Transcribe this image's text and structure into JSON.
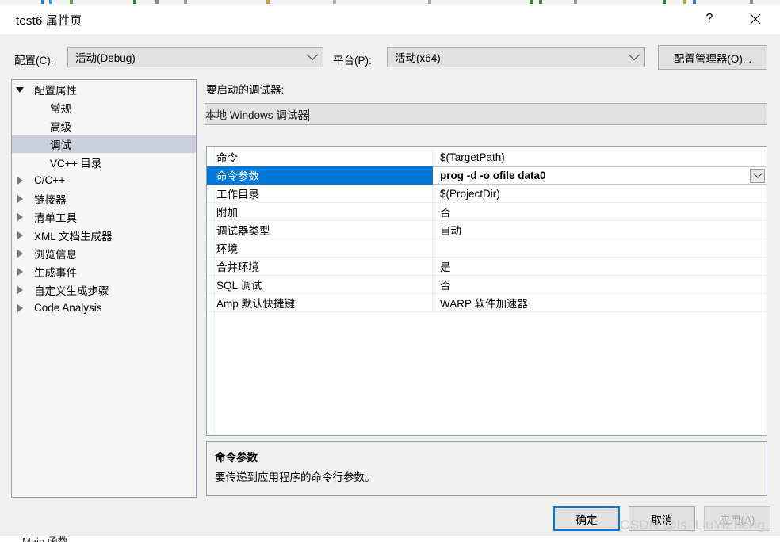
{
  "window": {
    "title": "test6 属性页",
    "help_icon": "question-mark-icon",
    "close_icon": "close-icon"
  },
  "config_bar": {
    "config_label": "配置(C):",
    "config_value": "活动(Debug)",
    "platform_label": "平台(P):",
    "platform_value": "活动(x64)",
    "config_manager_label": "配置管理器(O)..."
  },
  "tree": {
    "items": [
      {
        "label": "配置属性",
        "indent": 0,
        "expander": "open",
        "selected": false
      },
      {
        "label": "常规",
        "indent": 1,
        "expander": "none",
        "selected": false
      },
      {
        "label": "高级",
        "indent": 1,
        "expander": "none",
        "selected": false
      },
      {
        "label": "调试",
        "indent": 1,
        "expander": "none",
        "selected": true
      },
      {
        "label": "VC++ 目录",
        "indent": 1,
        "expander": "none",
        "selected": false
      },
      {
        "label": "C/C++",
        "indent": 1,
        "expander": "closed",
        "selected": false
      },
      {
        "label": "链接器",
        "indent": 1,
        "expander": "closed",
        "selected": false
      },
      {
        "label": "清单工具",
        "indent": 1,
        "expander": "closed",
        "selected": false
      },
      {
        "label": "XML 文档生成器",
        "indent": 1,
        "expander": "closed",
        "selected": false
      },
      {
        "label": "浏览信息",
        "indent": 1,
        "expander": "closed",
        "selected": false
      },
      {
        "label": "生成事件",
        "indent": 1,
        "expander": "closed",
        "selected": false
      },
      {
        "label": "自定义生成步骤",
        "indent": 1,
        "expander": "closed",
        "selected": false
      },
      {
        "label": "Code Analysis",
        "indent": 1,
        "expander": "closed",
        "selected": false
      }
    ]
  },
  "right_pane": {
    "debugger_label": "要启动的调试器:",
    "debugger_value": "本地 Windows 调试器"
  },
  "properties": {
    "rows": [
      {
        "name": "命令",
        "value": "$(TargetPath)",
        "selected": false,
        "has_dropdown": false
      },
      {
        "name": "命令参数",
        "value": "prog -d -o ofile data0",
        "selected": true,
        "has_dropdown": true
      },
      {
        "name": "工作目录",
        "value": "$(ProjectDir)",
        "selected": false,
        "has_dropdown": false
      },
      {
        "name": "附加",
        "value": "否",
        "selected": false,
        "has_dropdown": false
      },
      {
        "name": "调试器类型",
        "value": "自动",
        "selected": false,
        "has_dropdown": false
      },
      {
        "name": "环境",
        "value": "",
        "selected": false,
        "has_dropdown": false
      },
      {
        "name": "合并环境",
        "value": "是",
        "selected": false,
        "has_dropdown": false
      },
      {
        "name": "SQL 调试",
        "value": "否",
        "selected": false,
        "has_dropdown": false
      },
      {
        "name": "Amp 默认快捷键",
        "value": "WARP 软件加速器",
        "selected": false,
        "has_dropdown": false
      }
    ]
  },
  "description": {
    "title": "命令参数",
    "body": "要传递到应用程序的命令行参数。"
  },
  "footer": {
    "ok_label": "确定",
    "cancel_label": "取消",
    "apply_label": "应用(A)"
  },
  "watermark": "CSDN @ls_LiuYiZheng",
  "background": {
    "bottom_text": "Main 函数..."
  },
  "colors": {
    "accent": "#0078d7",
    "tree_selection": "#cbcfdd",
    "dialog_bg": "#f0f0f0",
    "control_bg": "#e1e1e1"
  }
}
